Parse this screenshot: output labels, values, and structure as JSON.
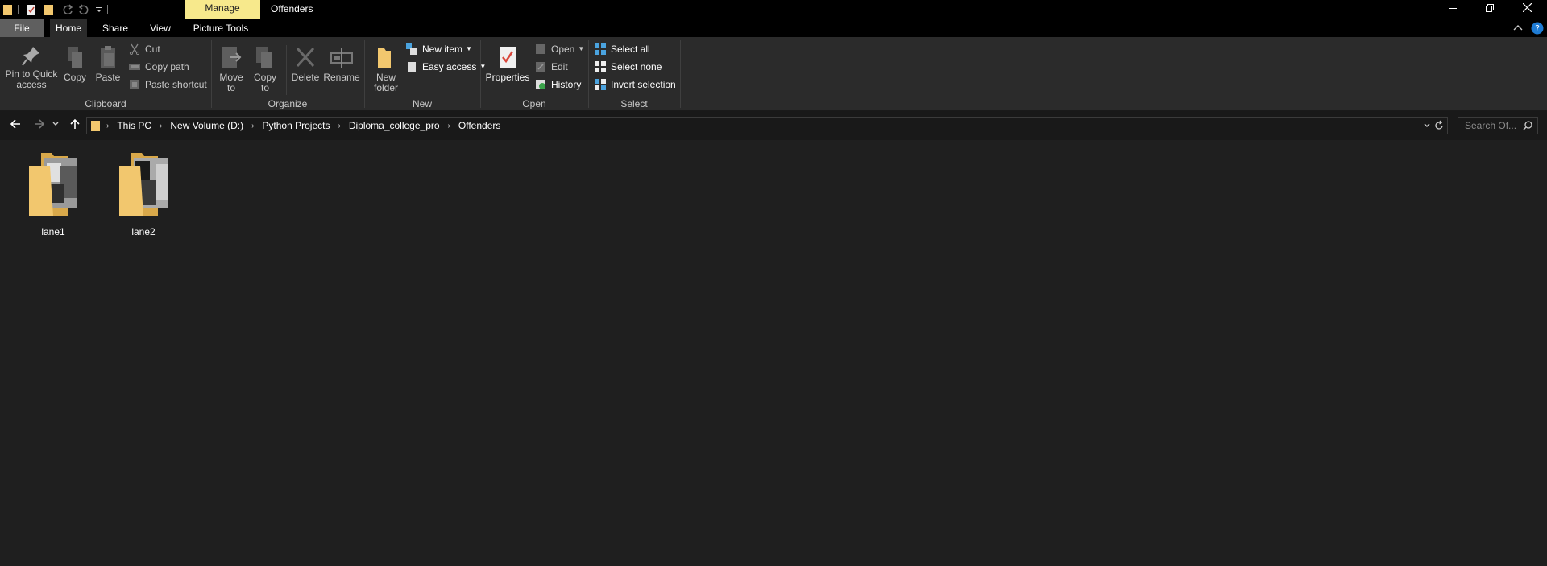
{
  "window": {
    "title": "Offenders",
    "context_tab": "Manage",
    "controls": [
      "minimize",
      "restore",
      "close"
    ]
  },
  "ribbon_tabs": [
    {
      "label": "File"
    },
    {
      "label": "Home",
      "active": true
    },
    {
      "label": "Share"
    },
    {
      "label": "View"
    },
    {
      "label": "Picture Tools"
    }
  ],
  "ribbon": {
    "clipboard": {
      "pin": "Pin to Quick access",
      "copy": "Copy",
      "paste": "Paste",
      "cut": "Cut",
      "copy_path": "Copy path",
      "paste_shortcut": "Paste shortcut",
      "label": "Clipboard"
    },
    "organize": {
      "move_to": "Move to",
      "copy_to": "Copy to",
      "delete": "Delete",
      "rename": "Rename",
      "label": "Organize"
    },
    "new": {
      "new_folder": "New folder",
      "new_item": "New item",
      "easy_access": "Easy access",
      "label": "New"
    },
    "open": {
      "properties": "Properties",
      "open": "Open",
      "edit": "Edit",
      "history": "History",
      "label": "Open"
    },
    "select": {
      "select_all": "Select all",
      "select_none": "Select none",
      "invert_selection": "Invert selection",
      "label": "Select"
    }
  },
  "address": {
    "crumbs": [
      "This PC",
      "New Volume (D:)",
      "Python Projects",
      "Diploma_college_pro",
      "Offenders"
    ],
    "search_placeholder": "Search Of..."
  },
  "items": [
    {
      "name": "lane1",
      "type": "folder"
    },
    {
      "name": "lane2",
      "type": "folder"
    }
  ],
  "colors": {
    "manage_tab": "#f7e98c",
    "folder": "#f2c76e",
    "background": "#1f1f1f",
    "ribbon": "#2b2b2b"
  }
}
